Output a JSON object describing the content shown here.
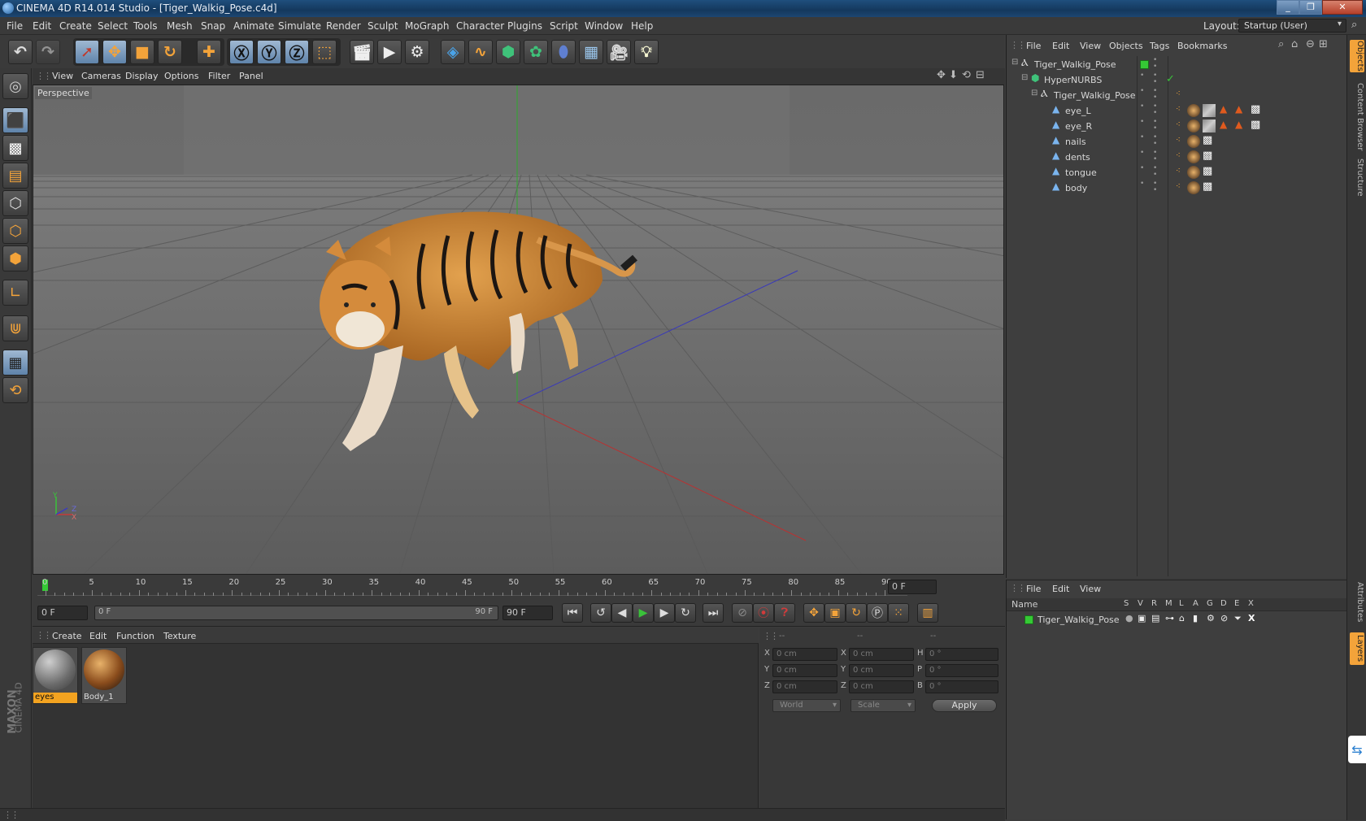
{
  "titlebar": {
    "title": "CINEMA 4D R14.014 Studio - [Tiger_Walkig_Pose.c4d]",
    "minimize": "_",
    "restore": "❐",
    "close": "✕"
  },
  "menubar": {
    "items": [
      "File",
      "Edit",
      "Create",
      "Select",
      "Tools",
      "Mesh",
      "Snap",
      "Animate",
      "Simulate",
      "Render",
      "Sculpt",
      "MoGraph",
      "Character",
      "Plugins",
      "Script",
      "Window",
      "Help"
    ],
    "layout_label": "Layout:",
    "layout_value": "Startup (User)"
  },
  "viewport": {
    "menu": [
      "View",
      "Cameras",
      "Display",
      "Options",
      "Filter",
      "Panel"
    ],
    "label": "Perspective",
    "axis_y": "Y",
    "axis_z": "Z",
    "axis_x": "X"
  },
  "timeline": {
    "ticks": [
      "0",
      "5",
      "10",
      "15",
      "20",
      "25",
      "30",
      "35",
      "40",
      "45",
      "50",
      "55",
      "60",
      "65",
      "70",
      "75",
      "80",
      "85",
      "90"
    ],
    "end_field": "0 F"
  },
  "playbar": {
    "current_frame": "0 F",
    "range_start": "0 F",
    "range_end_inner": "90 F",
    "range_end": "90 F"
  },
  "materials": {
    "menu": [
      "Create",
      "Edit",
      "Function",
      "Texture"
    ],
    "items": [
      {
        "name": "eyes"
      },
      {
        "name": "Body_1"
      }
    ]
  },
  "coords": {
    "headers": [
      "--",
      "--",
      "--"
    ],
    "rows": [
      {
        "a": "X",
        "av": "0 cm",
        "b": "X",
        "bv": "0 cm",
        "c": "H",
        "cv": "0 °"
      },
      {
        "a": "Y",
        "av": "0 cm",
        "b": "Y",
        "bv": "0 cm",
        "c": "P",
        "cv": "0 °"
      },
      {
        "a": "Z",
        "av": "0 cm",
        "b": "Z",
        "bv": "0 cm",
        "c": "B",
        "cv": "0 °"
      }
    ],
    "world": "World",
    "scale": "Scale",
    "apply": "Apply"
  },
  "objects": {
    "menu": [
      "File",
      "Edit",
      "View",
      "Objects",
      "Tags",
      "Bookmarks"
    ],
    "rows": [
      {
        "name": "Tiger_Walkig_Pose"
      },
      {
        "name": "HyperNURBS"
      },
      {
        "name": "Tiger_Walkig_Pose"
      },
      {
        "name": "eye_L"
      },
      {
        "name": "eye_R"
      },
      {
        "name": "nails"
      },
      {
        "name": "dents"
      },
      {
        "name": "tongue"
      },
      {
        "name": "body"
      }
    ]
  },
  "layers": {
    "menu": [
      "File",
      "Edit",
      "View"
    ],
    "col_name": "Name",
    "cols": [
      "S",
      "V",
      "R",
      "M",
      "L",
      "A",
      "G",
      "D",
      "E",
      "X"
    ],
    "row_name": "Tiger_Walkig_Pose"
  },
  "rightstrip": {
    "tabs": [
      "Objects",
      "Content Browser",
      "Structure",
      "Attributes",
      "Layers"
    ]
  },
  "branding": {
    "maxon": "MAXON",
    "cinema": "CINEMA 4D"
  },
  "colors": {
    "accent_blue": "#5f83aa",
    "orange": "#f3a33a",
    "layer_green": "#35c935",
    "material_selected": "#f3a320"
  }
}
